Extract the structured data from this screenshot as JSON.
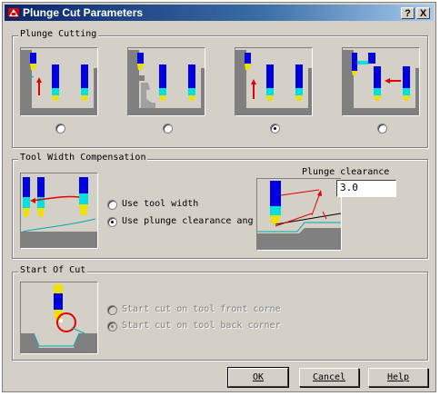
{
  "window": {
    "title": "Plunge Cut Parameters",
    "help_button": "?",
    "close_button": "X"
  },
  "plunge_cutting": {
    "group_label": "Plunge Cutting",
    "options": [
      {
        "selected": false
      },
      {
        "selected": false
      },
      {
        "selected": true
      },
      {
        "selected": false
      }
    ]
  },
  "tool_width_compensation": {
    "group_label": "Tool Width Compensation",
    "options": [
      {
        "label": "Use tool width",
        "selected": false
      },
      {
        "label": "Use plunge clearance ang",
        "selected": true
      }
    ],
    "clearance_label": "Plunge clearance",
    "clearance_value": "3.0"
  },
  "start_of_cut": {
    "group_label": "Start Of Cut",
    "options": [
      {
        "label": "Start cut on tool front corne",
        "selected": false,
        "enabled": false
      },
      {
        "label": "Start cut on tool back corner",
        "selected": true,
        "enabled": false
      }
    ]
  },
  "buttons": {
    "ok": "OK",
    "cancel": "Cancel",
    "help": "Help"
  },
  "colors": {
    "title_start": "#0a246a",
    "title_end": "#a6caf0",
    "tool_blue": "#0000e0",
    "insert_cyan": "#00e0e0",
    "insert_yellow": "#f0e000",
    "workpiece_gray": "#808080",
    "arrow_red": "#e00000"
  }
}
